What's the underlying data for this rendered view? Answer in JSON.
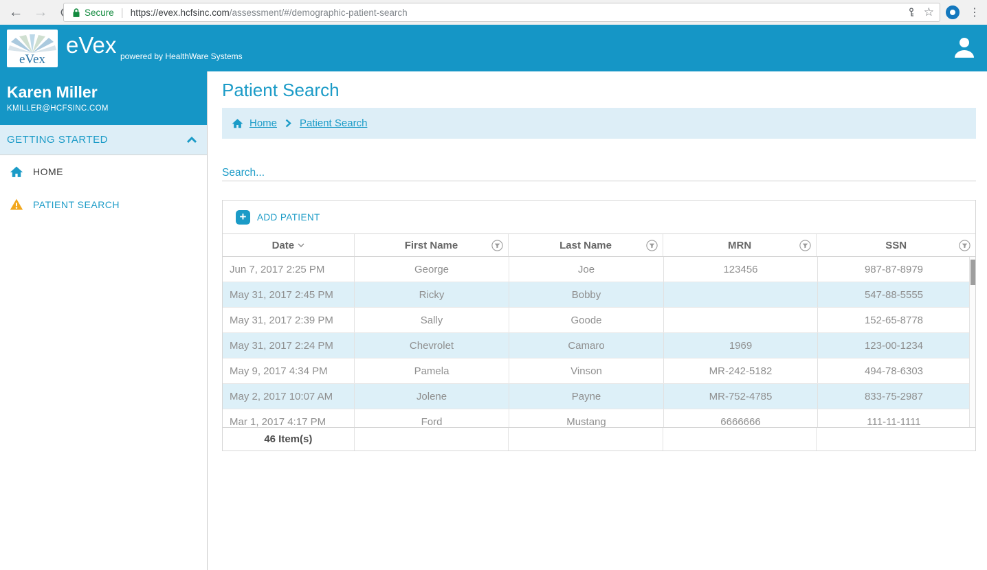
{
  "browser": {
    "security_label": "Secure",
    "url_origin": "https://evex.hcfsinc.com",
    "url_path": "/assessment/#/demographic-patient-search",
    "icons": {
      "back": "←",
      "forward": "→",
      "star": "☆",
      "menu": "⋮",
      "separator": "|"
    }
  },
  "header": {
    "logo_text": "eVex",
    "app_name": "eVex",
    "tagline": "powered by HealthWare Systems"
  },
  "sidebar": {
    "user": {
      "name": "Karen Miller",
      "email": "KMILLER@HCFSINC.COM"
    },
    "section_label": "GETTING STARTED",
    "items": [
      {
        "label": "HOME",
        "icon": "home-icon"
      },
      {
        "label": "PATIENT SEARCH",
        "icon": "warning-icon"
      }
    ]
  },
  "main": {
    "title": "Patient Search",
    "breadcrumb": {
      "items": [
        "Home",
        "Patient Search"
      ]
    },
    "search": {
      "placeholder": "Search..."
    },
    "toolbar": {
      "add_patient_label": "ADD PATIENT"
    },
    "table": {
      "columns": [
        {
          "label": "Date",
          "sort": "expanded",
          "filter": false
        },
        {
          "label": "First Name",
          "filter": true
        },
        {
          "label": "Last Name",
          "filter": true
        },
        {
          "label": "MRN",
          "filter": true
        },
        {
          "label": "SSN",
          "filter": true
        }
      ],
      "rows": [
        [
          "Jun 7, 2017 2:25 PM",
          "George",
          "Joe",
          "123456",
          "987-87-8979"
        ],
        [
          "May 31, 2017 2:45 PM",
          "Ricky",
          "Bobby",
          "",
          "547-88-5555"
        ],
        [
          "May 31, 2017 2:39 PM",
          "Sally",
          "Goode",
          "",
          "152-65-8778"
        ],
        [
          "May 31, 2017 2:24 PM",
          "Chevrolet",
          "Camaro",
          "1969",
          "123-00-1234"
        ],
        [
          "May 9, 2017 4:34 PM",
          "Pamela",
          "Vinson",
          "MR-242-5182",
          "494-78-6303"
        ],
        [
          "May 2, 2017 10:07 AM",
          "Jolene",
          "Payne",
          "MR-752-4785",
          "833-75-2987"
        ],
        [
          "Mar 1, 2017 4:17 PM",
          "Ford",
          "Mustang",
          "6666666",
          "111-11-1111"
        ]
      ],
      "footer_count": "46 Item(s)"
    }
  },
  "colors": {
    "brand_teal": "#1596c6",
    "link_teal": "#1b9bc7",
    "light_blue_bg": "#ddeef7",
    "row_stripe": "#ddf0f8",
    "warning_yellow": "#f2a71d",
    "secure_green": "#128a3e"
  }
}
